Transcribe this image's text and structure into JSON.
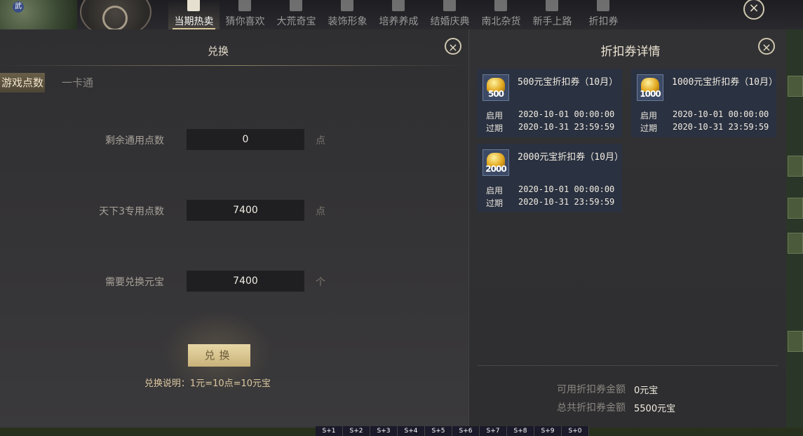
{
  "topnav": {
    "avatar_badge": "武",
    "tabs": [
      {
        "label": "当期热卖",
        "active": true
      },
      {
        "label": "猜你喜欢"
      },
      {
        "label": "大荒奇宝"
      },
      {
        "label": "装饰形象"
      },
      {
        "label": "培养养成"
      },
      {
        "label": "结婚庆典"
      },
      {
        "label": "南北杂货"
      },
      {
        "label": "新手上路"
      },
      {
        "label": "折扣券"
      }
    ],
    "close_icon": "×"
  },
  "exchange": {
    "title": "兑换",
    "close_icon": "×",
    "tabs": {
      "game_points": "游戏点数",
      "card": "一卡通"
    },
    "rows": [
      {
        "label": "剩余通用点数",
        "value": "0",
        "unit": "点"
      },
      {
        "label": "天下3专用点数",
        "value": "7400",
        "unit": "点"
      },
      {
        "label": "需要兑换元宝",
        "value": "7400",
        "unit": "个"
      }
    ],
    "button": "兑换",
    "note": "兑换说明：1元=10点=10元宝"
  },
  "coupons": {
    "title": "折扣券详情",
    "close_icon": "×",
    "start_label": "启用",
    "end_label": "过期",
    "items": [
      {
        "icon_num": "500",
        "name": "500元宝折扣券（10月）",
        "start": "2020-10-01 00:00:00",
        "end": "2020-10-31 23:59:59"
      },
      {
        "icon_num": "1000",
        "name": "1000元宝折扣券（10月）",
        "start": "2020-10-01 00:00:00",
        "end": "2020-10-31 23:59:59"
      },
      {
        "icon_num": "2000",
        "name": "2000元宝折扣券（10月）",
        "start": "2020-10-01 00:00:00",
        "end": "2020-10-31 23:59:59"
      }
    ],
    "available_label": "可用折扣券金额",
    "available_value": "0元宝",
    "total_label": "总共折扣券金额",
    "total_value": "5500元宝"
  },
  "hotbar": [
    "S+1",
    "S+2",
    "S+3",
    "S+4",
    "S+5",
    "S+6",
    "S+7",
    "S+8",
    "S+9",
    "S+0"
  ]
}
